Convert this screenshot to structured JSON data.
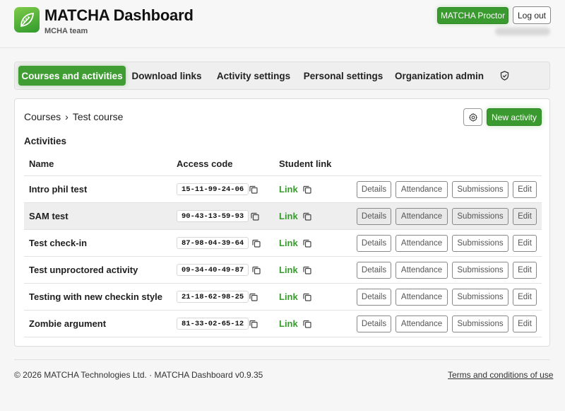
{
  "app": {
    "title": "MATCHA Dashboard",
    "team": "MCHA team",
    "accent_color": "#3a9a2f",
    "logo_icon": "leaf-icon"
  },
  "header": {
    "proctor_label": "MATCHA Proctor",
    "logout_label": "Log out"
  },
  "nav": {
    "items": [
      {
        "label": "Courses and activities",
        "active": true
      },
      {
        "label": "Download links",
        "active": false
      },
      {
        "label": "Activity settings",
        "active": false
      },
      {
        "label": "Personal settings",
        "active": false
      },
      {
        "label": "Organization admin",
        "active": false
      }
    ],
    "admin_icon": "shield-check-icon"
  },
  "breadcrumb": {
    "root": "Courses",
    "separator": "›",
    "current": "Test course"
  },
  "toolbar": {
    "settings_icon": "gear-icon",
    "new_activity_label": "New activity"
  },
  "activities": {
    "section_title": "Activities",
    "columns": [
      "Name",
      "Access code",
      "Student link"
    ],
    "link_label": "Link",
    "actions": [
      "Details",
      "Attendance",
      "Submissions",
      "Edit"
    ],
    "rows": [
      {
        "name": "Intro phil test",
        "code": "15-11-99-24-06"
      },
      {
        "name": "SAM test",
        "code": "90-43-13-59-93"
      },
      {
        "name": "Test check-in",
        "code": "87-98-04-39-64"
      },
      {
        "name": "Test unproctored activity",
        "code": "09-34-40-49-87"
      },
      {
        "name": "Testing with new checkin style",
        "code": "21-18-62-98-25"
      },
      {
        "name": "Zombie argument",
        "code": "81-33-02-65-12"
      }
    ]
  },
  "footer": {
    "copyright": "© 2026 MATCHA Technologies Ltd. · MATCHA Dashboard v0.9.35",
    "terms": "Terms and conditions of use"
  }
}
